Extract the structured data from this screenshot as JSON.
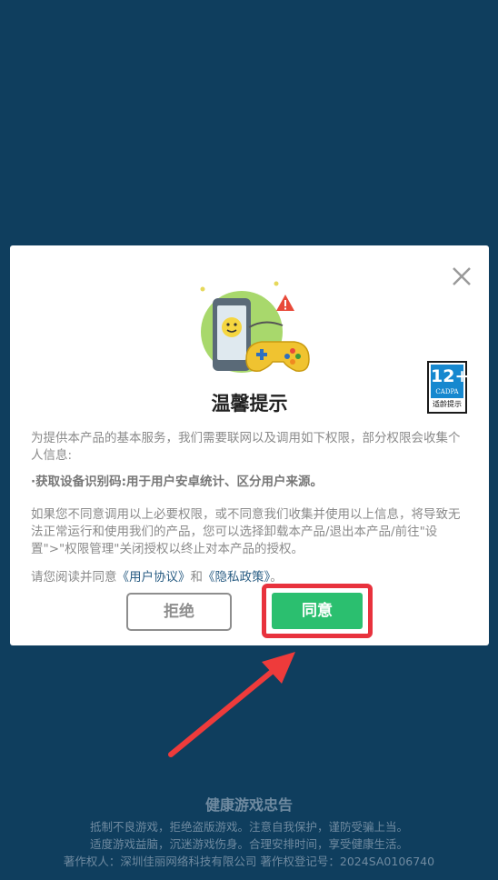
{
  "dialog": {
    "title": "温馨提示",
    "intro": "为提供本产品的基本服务，我们需要联网以及调用如下权限，部分权限会收集个人信息:",
    "permission_item": "·获取设备识别码:用于用户安卓统计、区分用户来源。",
    "disclaimer": "如果您不同意调用以上必要权限，或不同意我们收集并使用以上信息，将导致无法正常运行和使用我们的产品，您可以选择卸载本产品/退出本产品/前往\"设置\">\"权限管理\"关闭授权以终止对本产品的授权。",
    "agree_prefix": "请您阅读并同意",
    "user_agreement": "《用户协议》",
    "agree_and": "和",
    "privacy_policy": "《隐私政策》",
    "agree_suffix": "。",
    "reject_label": "拒绝",
    "agree_label": "同意",
    "close_icon": "close-icon"
  },
  "age_badge": {
    "rating": "12+",
    "org": "CADPA",
    "label": "适龄提示"
  },
  "footer": {
    "title": "健康游戏忠告",
    "line1": "抵制不良游戏，拒绝盗版游戏。注意自我保护，谨防受骗上当。",
    "line2": "适度游戏益脑，沉迷游戏伤身。合理安排时间，享受健康生活。",
    "line3": "著作权人：深圳佳丽网络科技有限公司 著作权登记号：2024SA0106740"
  },
  "colors": {
    "background": "#0f3e5e",
    "agree_button": "#2bbf6f",
    "highlight": "#e8323d",
    "badge_blue": "#1688cf"
  }
}
